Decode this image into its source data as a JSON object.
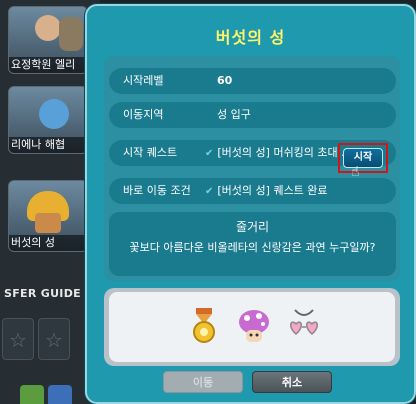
{
  "background": {
    "cards": [
      {
        "caption": "요정학원 엘리"
      },
      {
        "caption": "리에나 해협"
      },
      {
        "caption": "버섯의 성"
      }
    ],
    "guide_label": "SFER GUIDE",
    "slot_icon": "☆"
  },
  "dialog": {
    "title": "버섯의 성",
    "rows": {
      "level": {
        "label": "시작레벨",
        "value": "60"
      },
      "area": {
        "label": "이동지역",
        "value": "성 입구"
      },
      "start_quest": {
        "label": "시작 퀘스트",
        "value": "[버섯의 성] 머쉬킹의 초대..."
      },
      "condition": {
        "label": "바로 이동 조건",
        "value": "[버섯의 성] 퀘스트 완료"
      }
    },
    "start_button": "시작",
    "summary": {
      "title": "줄거리",
      "text": "꽃보다 아름다운 비올레타의 신랑감은 과연 누구일까?"
    },
    "buttons": {
      "move": "이동",
      "cancel": "취소"
    }
  },
  "icons": {
    "check": "✔",
    "cursor": "☝"
  },
  "colors": {
    "dialog_bg": "#1e99ad",
    "title": "#fff46a",
    "highlight": "#d0161a"
  }
}
